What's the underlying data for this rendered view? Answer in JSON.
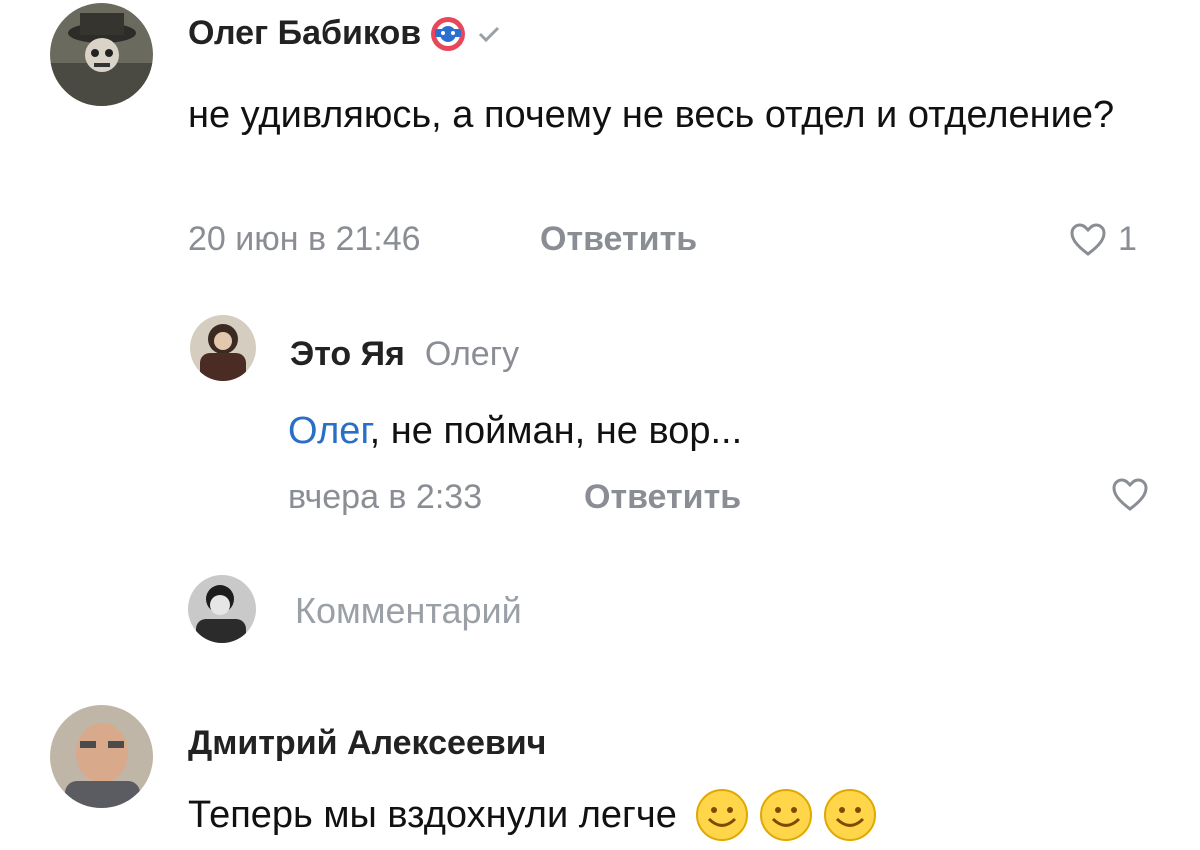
{
  "comments": [
    {
      "author": "Олег Бабиков",
      "text": "не удивляюсь, а почему не весь отдел и отделение?",
      "date": "20 июн в 21:46",
      "reply_label": "Ответить",
      "likes": "1",
      "icons": [
        "captain-shield-badge-icon",
        "checkmark-icon",
        "heart-icon"
      ],
      "reply": {
        "author": "Это Яя",
        "to": "Олегу",
        "mention": "Олег",
        "text": ", не пойман, не вор...",
        "date": "вчера в 2:33",
        "reply_label": "Ответить"
      }
    },
    {
      "author": "Дмитрий Алексеевич",
      "text": "Теперь мы вздохнули легче",
      "icons": [
        "smile-emoji-icon",
        "smile-emoji-icon",
        "smile-emoji-icon"
      ]
    }
  ],
  "composer": {
    "placeholder": "Комментарий"
  },
  "colors": {
    "mention": "#2a6fc6",
    "meta": "#8a8e94"
  }
}
